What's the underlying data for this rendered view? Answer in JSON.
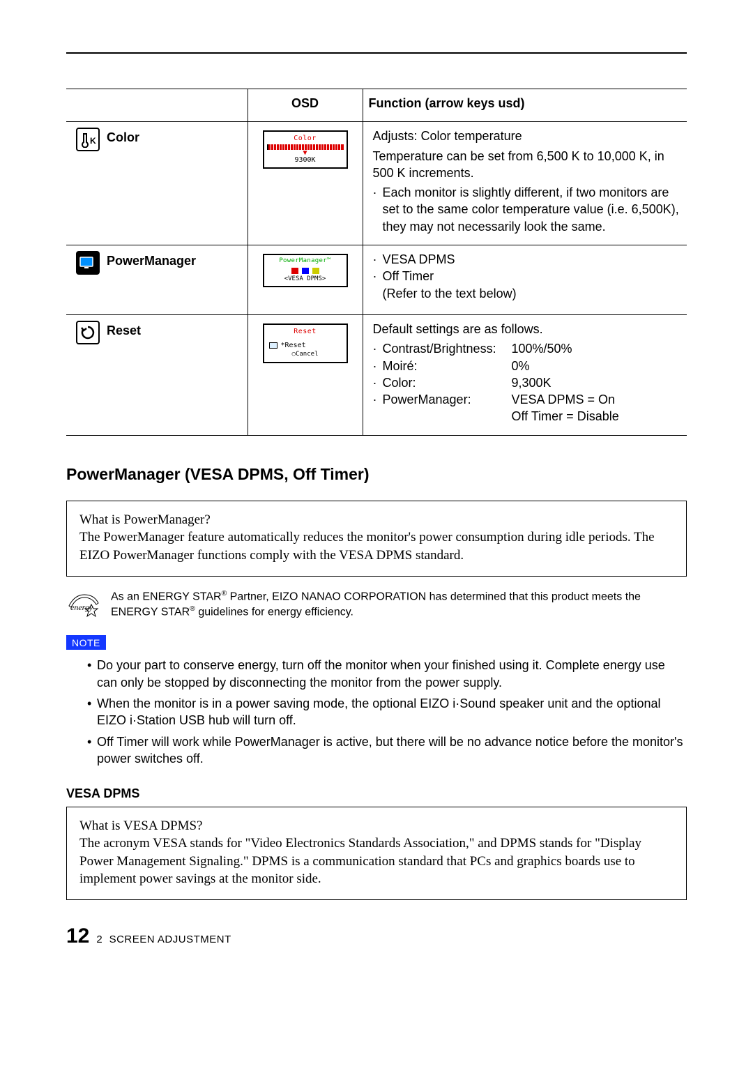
{
  "table": {
    "headers": {
      "osd": "OSD",
      "func": "Function (arrow keys usd)"
    },
    "rows": [
      {
        "id": "color",
        "name": "Color",
        "osd": {
          "title": "Color",
          "value": "9300K"
        },
        "func": {
          "l1": "Adjusts:   Color temperature",
          "l2": "Temperature can be set from 6,500 K to 10,000 K, in 500 K increments.",
          "bullet": "Each monitor is slightly different, if two monitors are set to the same color temperature value (i.e. 6,500K), they may not necessarily look the same."
        }
      },
      {
        "id": "pm",
        "name": "PowerManager",
        "osd": {
          "title": "PowerManager™",
          "value": "<VESA DPMS>"
        },
        "func": {
          "b1": "VESA DPMS",
          "b2": "Off Timer",
          "l3": "(Refer to the text below)"
        }
      },
      {
        "id": "reset",
        "name": "Reset",
        "osd": {
          "title": "Reset",
          "line1": "*Reset",
          "line2": "○Cancel"
        },
        "func": {
          "l1": "Default settings are as follows.",
          "kv": [
            {
              "k": "Contrast/Brightness:",
              "v": "100%/50%"
            },
            {
              "k": "Moiré:",
              "v": "0%"
            },
            {
              "k": "Color:",
              "v": "9,300K"
            },
            {
              "k": "PowerManager:",
              "v": "VESA DPMS = On"
            },
            {
              "k": "",
              "v": "Off Timer = Disable"
            }
          ]
        }
      }
    ]
  },
  "section_heading": "PowerManager (VESA DPMS, Off Timer)",
  "box1": {
    "q": "What is PowerManager?",
    "a": "The PowerManager feature automatically reduces the monitor's power consumption during idle periods.  The EIZO PowerManager functions comply with the VESA DPMS standard."
  },
  "energy": "As an ENERGY STAR® Partner, EIZO NANAO CORPORATION has determined that this product meets the ENERGY STAR® guidelines for energy efficiency.",
  "note_label": "NOTE",
  "notes": [
    "Do your part to conserve energy, turn off the monitor when your finished using it.  Complete energy use can only be stopped by disconnecting the monitor from the power supply.",
    "When the monitor is in a power saving mode, the optional EIZO i·Sound speaker unit and the optional EIZO i·Station USB hub will turn off.",
    "Off Timer will work while PowerManager is active, but there will be no advance notice before the monitor's power switches off."
  ],
  "sub_heading": "VESA DPMS",
  "box2": {
    "q": "What is VESA DPMS?",
    "a": "The acronym VESA stands for \"Video Electronics Standards Association,\" and DPMS stands for \"Display Power Management Signaling.\"  DPMS is a communication standard that PCs and graphics boards use to implement power savings at the monitor side."
  },
  "footer": {
    "page": "12",
    "chapter_num": "2",
    "chapter_title": "SCREEN ADJUSTMENT"
  }
}
